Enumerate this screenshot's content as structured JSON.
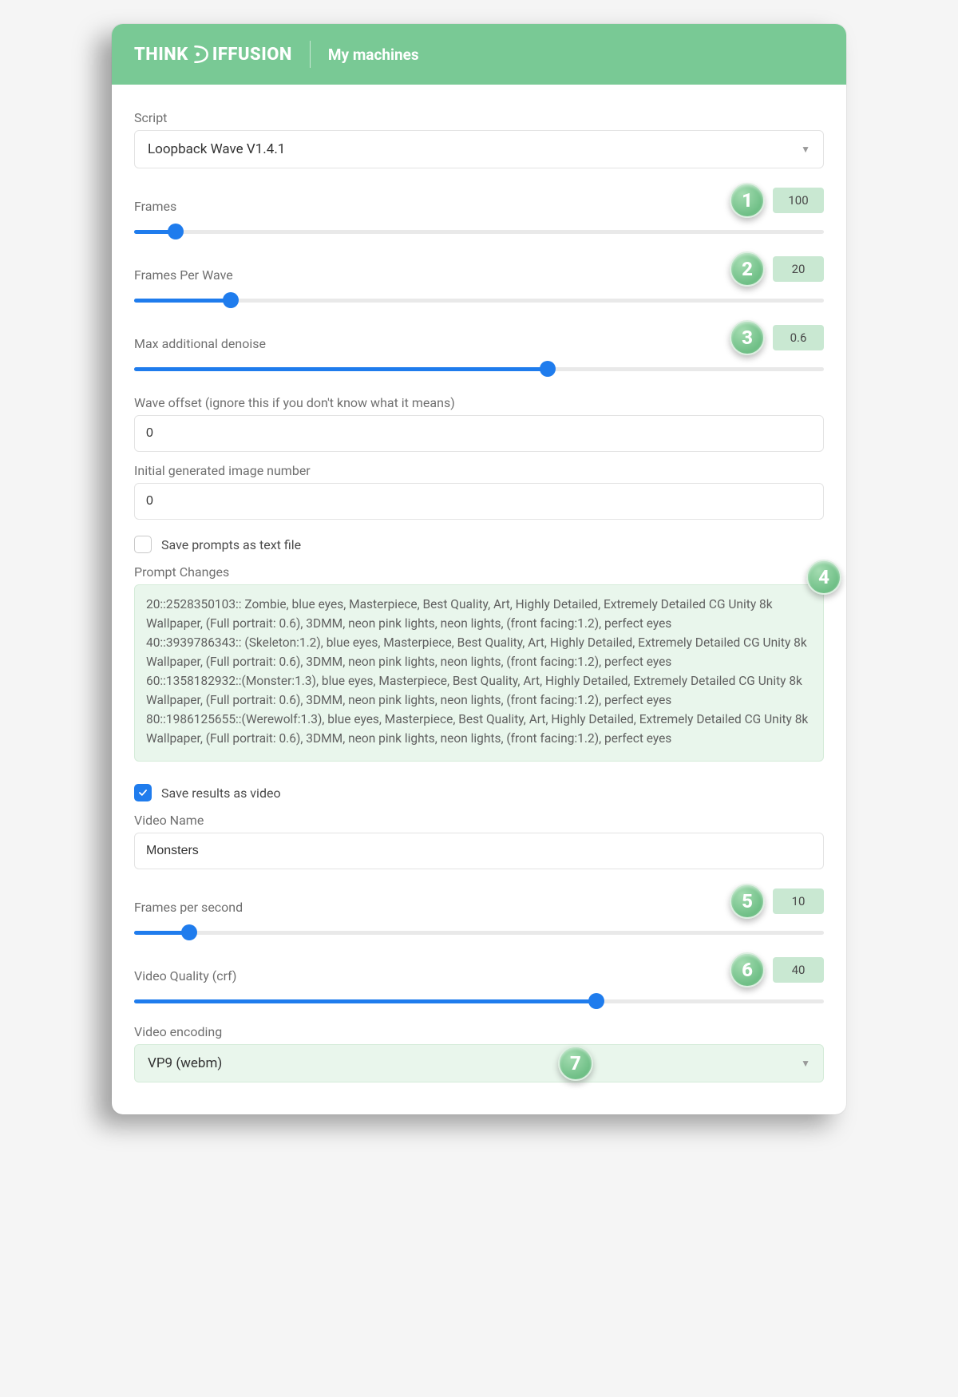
{
  "brand": {
    "part1": "THINK",
    "part2": "IFFUSION"
  },
  "header": {
    "title": "My machines"
  },
  "script": {
    "label": "Script",
    "value": "Loopback Wave V1.4.1"
  },
  "frames": {
    "label": "Frames",
    "value": "100",
    "fillPct": 6
  },
  "frames_per_wave": {
    "label": "Frames Per Wave",
    "value": "20",
    "fillPct": 14
  },
  "max_denoise": {
    "label": "Max additional denoise",
    "value": "0.6",
    "fillPct": 60
  },
  "wave_offset": {
    "label": "Wave offset (ignore this if you don't know what it means)",
    "value": "0"
  },
  "initial_img_num": {
    "label": "Initial generated image number",
    "value": "0"
  },
  "save_prompts": {
    "label": "Save prompts as text file",
    "checked": false
  },
  "prompt_changes": {
    "label": "Prompt Changes",
    "text": "20::2528350103:: Zombie, blue eyes, Masterpiece, Best Quality, Art, Highly Detailed, Extremely Detailed CG Unity 8k Wallpaper, (Full portrait: 0.6), 3DMM, neon pink lights, neon lights, (front facing:1.2), perfect eyes\n40::3939786343:: (Skeleton:1.2), blue eyes, Masterpiece, Best Quality, Art, Highly Detailed, Extremely Detailed CG Unity 8k Wallpaper, (Full portrait: 0.6), 3DMM, neon pink lights, neon lights, (front facing:1.2), perfect eyes\n60::1358182932::(Monster:1.3), blue eyes, Masterpiece, Best Quality, Art, Highly Detailed, Extremely Detailed CG Unity 8k Wallpaper, (Full portrait: 0.6), 3DMM, neon pink lights, neon lights, (front facing:1.2), perfect eyes\n80::1986125655::(Werewolf:1.3), blue eyes, Masterpiece, Best Quality, Art, Highly Detailed, Extremely Detailed CG Unity 8k Wallpaper, (Full portrait: 0.6), 3DMM, neon pink lights, neon lights, (front facing:1.2), perfect eyes"
  },
  "save_video": {
    "label": "Save results as video",
    "checked": true
  },
  "video_name": {
    "label": "Video Name",
    "value": "Monsters"
  },
  "fps": {
    "label": "Frames per second",
    "value": "10",
    "fillPct": 8
  },
  "video_quality": {
    "label": "Video Quality (crf)",
    "value": "40",
    "fillPct": 67
  },
  "video_encoding": {
    "label": "Video encoding",
    "value": "VP9 (webm)"
  },
  "callouts": {
    "c1": "1",
    "c2": "2",
    "c3": "3",
    "c4": "4",
    "c5": "5",
    "c6": "6",
    "c7": "7"
  }
}
